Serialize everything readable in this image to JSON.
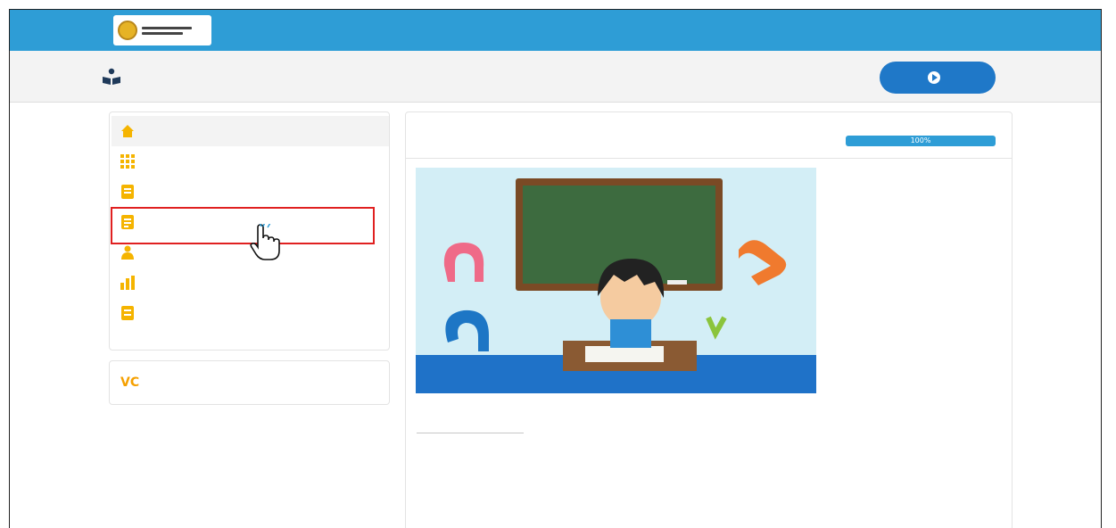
{
  "window": {
    "logo_lines": 2,
    "close_label": "×"
  },
  "header": {
    "title": "",
    "enter_button": ""
  },
  "menu": {
    "items": [
      {
        "label": "",
        "icon": "home-icon",
        "active": true
      },
      {
        "label": "",
        "icon": "grid-icon",
        "active": false
      },
      {
        "label": "",
        "icon": "worksheet-icon",
        "active": false
      },
      {
        "label": "",
        "icon": "assignment-icon",
        "active": false
      },
      {
        "label": "",
        "icon": "teacher-icon",
        "active": false
      },
      {
        "label": "",
        "icon": "chart-icon",
        "active": false
      },
      {
        "label": "",
        "icon": "history-icon",
        "active": false
      }
    ],
    "online_class": {
      "badge": "VC",
      "label": ""
    }
  },
  "main": {
    "title": "",
    "progress": {
      "label": "",
      "value": "100%",
      "fraction": 1.0
    }
  },
  "banner": {
    "board_line_1": "",
    "board_line_2": ""
  },
  "description": {
    "heading": "",
    "text": ""
  },
  "colors": {
    "topbar": "#2e9dd6",
    "accent": "#1e66b0",
    "button": "#1f78c8",
    "highlight": "#e02020",
    "icon": "#f5b400"
  }
}
